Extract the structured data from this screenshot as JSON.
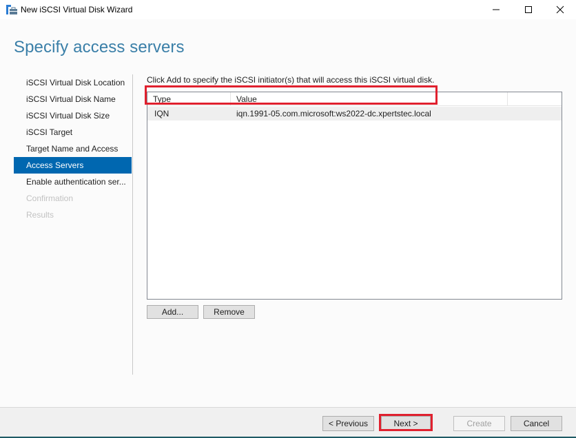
{
  "window": {
    "title": "New iSCSI Virtual Disk Wizard",
    "controls": {
      "minimize": "minimize",
      "maximize": "maximize",
      "close": "close"
    }
  },
  "page": {
    "title": "Specify access servers",
    "instruction": "Click Add to specify the iSCSI initiator(s) that will access this iSCSI virtual disk."
  },
  "nav": {
    "items": [
      {
        "label": "iSCSI Virtual Disk Location",
        "state": "normal"
      },
      {
        "label": "iSCSI Virtual Disk Name",
        "state": "normal"
      },
      {
        "label": "iSCSI Virtual Disk Size",
        "state": "normal"
      },
      {
        "label": "iSCSI Target",
        "state": "normal"
      },
      {
        "label": "Target Name and Access",
        "state": "normal"
      },
      {
        "label": "Access Servers",
        "state": "active"
      },
      {
        "label": "Enable authentication ser...",
        "state": "normal"
      },
      {
        "label": "Confirmation",
        "state": "disabled"
      },
      {
        "label": "Results",
        "state": "disabled"
      }
    ]
  },
  "initiators": {
    "columns": [
      "Type",
      "Value"
    ],
    "rows": [
      {
        "type": "IQN",
        "value": "iqn.1991-05.com.microsoft:ws2022-dc.xpertstec.local"
      }
    ]
  },
  "list_buttons": {
    "add": "Add...",
    "remove": "Remove"
  },
  "footer": {
    "previous": "< Previous",
    "next": "Next >",
    "create": "Create",
    "cancel": "Cancel"
  },
  "colors": {
    "accent": "#0067b0",
    "title": "#3a7fa8",
    "annotation": "#e0202e"
  }
}
